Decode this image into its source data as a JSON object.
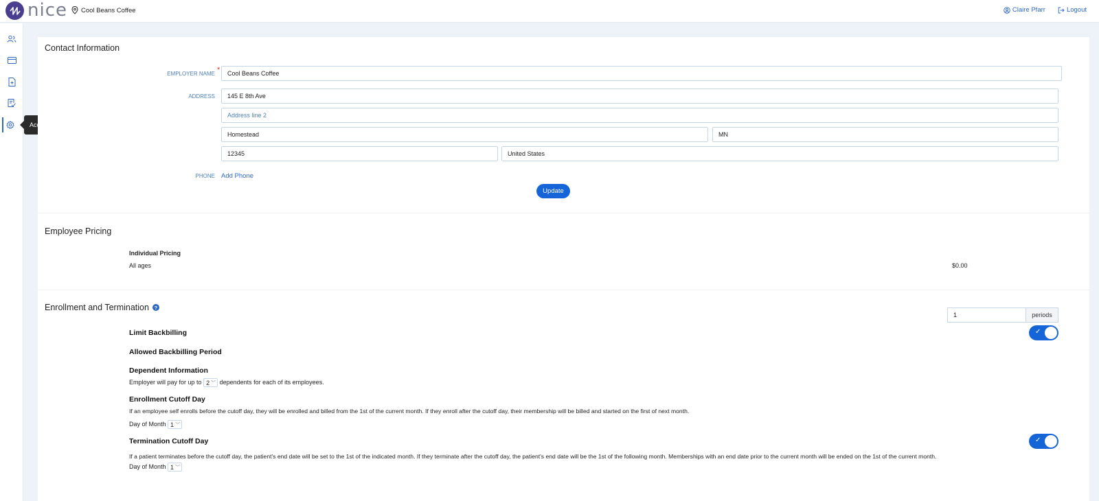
{
  "topbar": {
    "logo_text": "nice",
    "location": "Cool Beans Coffee",
    "user": "Claire Pfarr",
    "logout": "Logout"
  },
  "sidebar": {
    "items": [
      {
        "icon": "users-icon"
      },
      {
        "icon": "card-icon"
      },
      {
        "icon": "document-plus-icon"
      },
      {
        "icon": "checklist-icon"
      },
      {
        "icon": "gear-icon",
        "active": true
      }
    ],
    "tooltip": "Account & Pricing"
  },
  "contact": {
    "title": "Contact Information",
    "employer_label": "EMPLOYER NAME",
    "employer_value": "Cool Beans Coffee",
    "address_label": "ADDRESS",
    "address1": "145 E 8th Ave",
    "address2_placeholder": "Address line 2",
    "city": "Homestead",
    "state": "MN",
    "zip": "12345",
    "country": "United States",
    "phone_label": "PHONE",
    "add_phone": "Add Phone",
    "update_button": "Update"
  },
  "pricing": {
    "title": "Employee Pricing",
    "heading": "Individual Pricing",
    "row_label": "All ages",
    "row_value": "$0.00"
  },
  "enrollment": {
    "title": "Enrollment and Termination",
    "limit_backbilling": "Limit Backbilling",
    "limit_backbilling_on": true,
    "allowed_period_label": "Allowed Backbilling Period",
    "allowed_period_value": "1",
    "periods_unit": "periods",
    "dependent_heading": "Dependent Information",
    "dependent_pre": "Employer will pay for up to",
    "dependent_count": "2",
    "dependent_post": "dependents for each of its employees.",
    "enroll_cutoff_heading": "Enrollment Cutoff Day",
    "enroll_cutoff_desc": "If an employee self enrolls before the cutoff day, they will be enrolled and billed from the 1st of the current month. If they enroll after the cutoff day, their membership will be billed and started on the first of next month.",
    "day_of_month_label": "Day of Month",
    "enroll_day": "1",
    "term_cutoff_heading": "Termination Cutoff Day",
    "term_cutoff_on": true,
    "term_cutoff_desc": "If a patient terminates before the cutoff day, the patient's end date will be set to the 1st of the indicated month. If they terminate after the cutoff day, the patient's end date will be the 1st of the following month. Memberships with an end date prior to the current month will be ended on the 1st of the current month.",
    "term_day": "1"
  },
  "colors": {
    "accent": "#1665d8",
    "label_blue": "#4e7fb8",
    "logo_purple": "#4a3f8f"
  }
}
